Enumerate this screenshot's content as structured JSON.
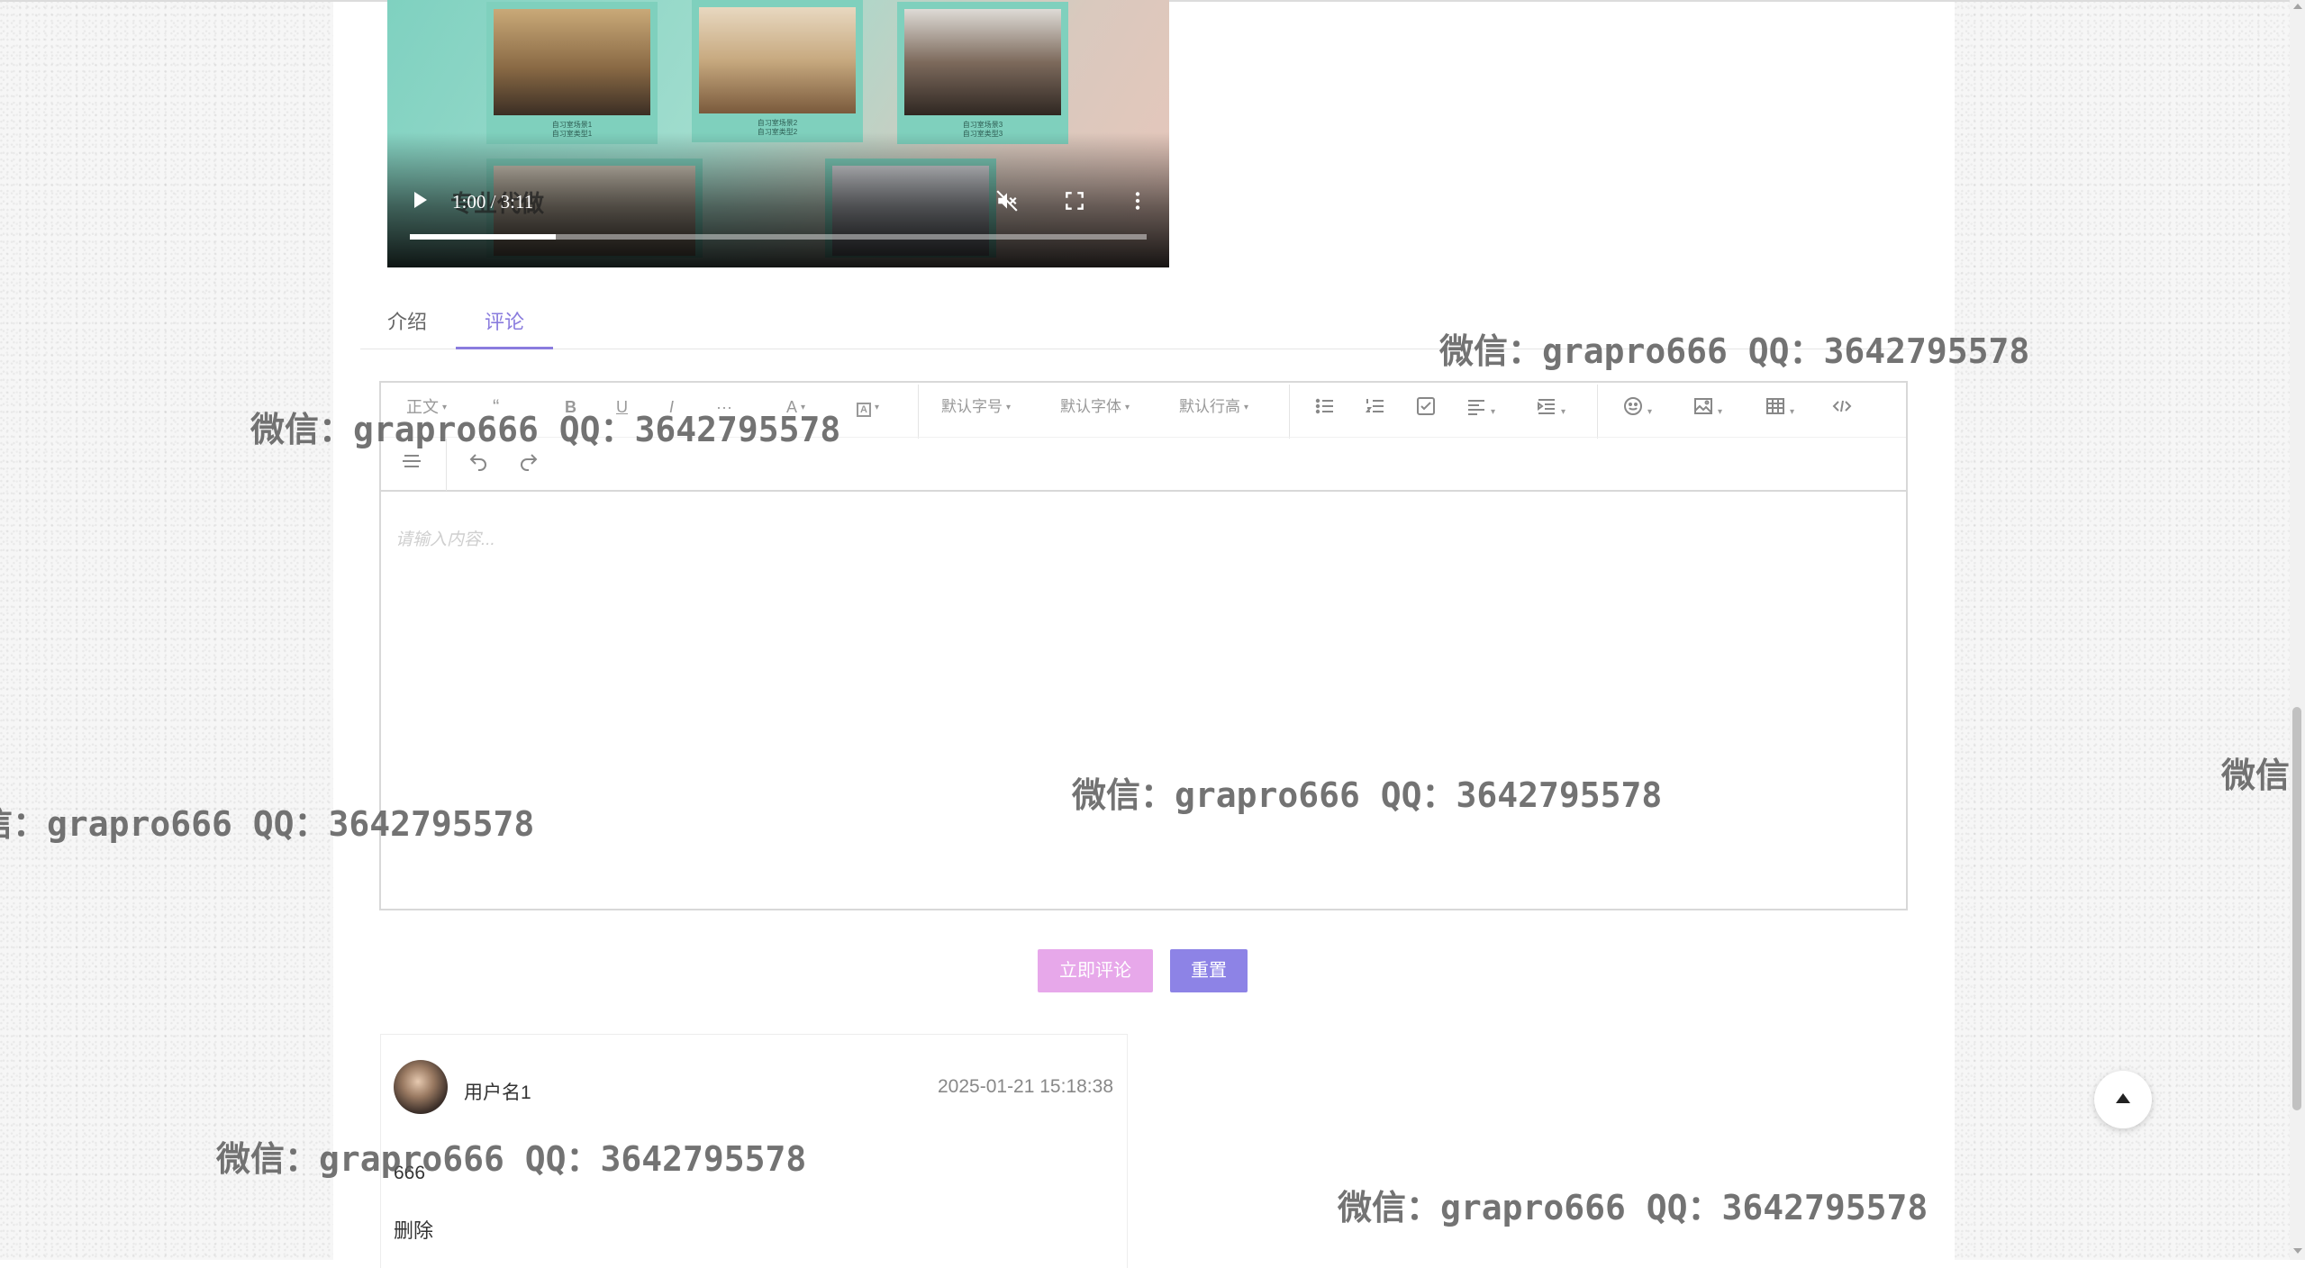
{
  "video": {
    "time_display": "1:00 / 3:11",
    "progress_fraction": 0.198,
    "photo_captions": [
      [
        "自习室场景1",
        "自习室类型1"
      ],
      [
        "自习室场景2",
        "自习室类型2"
      ],
      [
        "自习室场景3",
        "自习室类型3"
      ]
    ],
    "overlay_text": "专业代做"
  },
  "tabs": {
    "intro": "介绍",
    "comment": "评论",
    "active": "评论"
  },
  "editor": {
    "toolbar": {
      "paragraph": "正文",
      "font_size": "默认字号",
      "font_family": "默认字体",
      "line_height": "默认行高"
    },
    "placeholder": "请输入内容..."
  },
  "actions": {
    "submit": "立即评论",
    "reset": "重置"
  },
  "comment": {
    "username": "用户名1",
    "time": "2025-01-21 15:18:38",
    "content": "666",
    "delete_label": "删除"
  },
  "watermark": {
    "text": "微信：grapro666 QQ：3642795578",
    "partial": "微信："
  },
  "colors": {
    "accent": "#8a7cde",
    "submit_button": "#e7a8ea",
    "reset_button": "#8d83e6"
  }
}
